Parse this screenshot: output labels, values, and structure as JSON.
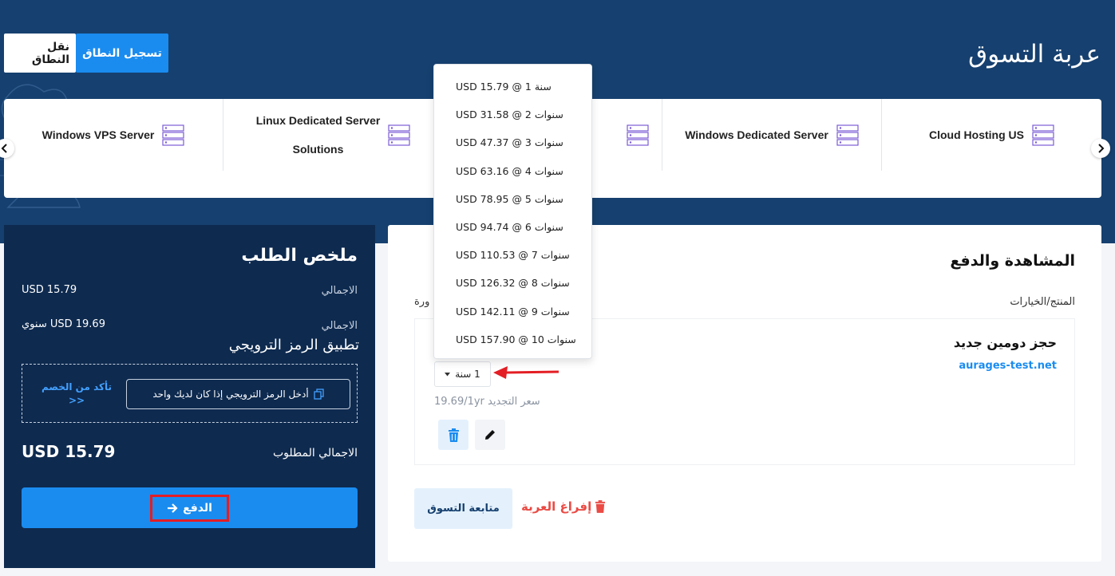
{
  "header": {
    "title": "عربة التسوق",
    "tabs": [
      {
        "label": "تسجيل النطاق",
        "active": true
      },
      {
        "label": "نقل النطاق",
        "active": false
      }
    ]
  },
  "carousel": {
    "items": [
      {
        "label": "Cloud Hosting US",
        "icon": "server-icon"
      },
      {
        "label": "Windows Dedicated Server",
        "icon": "server-icon"
      },
      {
        "label": "",
        "icon": "server-icon"
      },
      {
        "label": "Linux Dedicated Server",
        "label2": "Solutions",
        "icon": "server-icon"
      },
      {
        "label": "Windows VPS Server",
        "icon": "server-icon"
      }
    ],
    "prev_icon": "chevron-left-icon",
    "next_icon": "chevron-right-icon"
  },
  "summary": {
    "title": "ملخص الطلب",
    "subtotal_label": "الاجمالي",
    "subtotal_value": "USD 15.79",
    "recurring_label": "الاجمالي",
    "recurring_value": "USD 19.69 سنوي",
    "promo_title": "تطبيق الرمز الترويجي",
    "promo_placeholder": "أدخل الرمز الترويجي إذا كان لديك واحد",
    "promo_apply": "تأكد من الخصم",
    "promo_apply_arrow": ">>",
    "total_label": "الاجمالي المطلوب",
    "total_value": "USD 15.79",
    "checkout_label": "الدفع"
  },
  "review": {
    "title": "المشاهدة والدفع",
    "col_product": "المنتج/الخيارات",
    "col_price": "ورة",
    "item": {
      "title": "حجز دومين جديد",
      "domain": "aurages-test.net",
      "period_selected": "1 سنة",
      "renewal": "سعر التجديد 19.69/1yr"
    },
    "empty_cart": "إفراغ العربة",
    "continue_shopping": "متابعة التسوق"
  },
  "period_dropdown": {
    "options": [
      "USD 15.79 @ 1 سنة",
      "USD 31.58 @ 2 سنوات",
      "USD 47.37 @ 3 سنوات",
      "USD 63.16 @ 4 سنوات",
      "USD 78.95 @ 5 سنوات",
      "USD 94.74 @ 6 سنوات",
      "USD 110.53 @ 7 سنوات",
      "USD 126.32 @ 8 سنوات",
      "USD 142.11 @ 9 سنوات",
      "USD 157.90 @ 10 سنوات"
    ]
  },
  "colors": {
    "hero": "#16406f",
    "accent": "#1a8cf0",
    "summary_bg": "#0e2a4f",
    "danger": "#ea4b44",
    "highlight": "#e31e24"
  }
}
